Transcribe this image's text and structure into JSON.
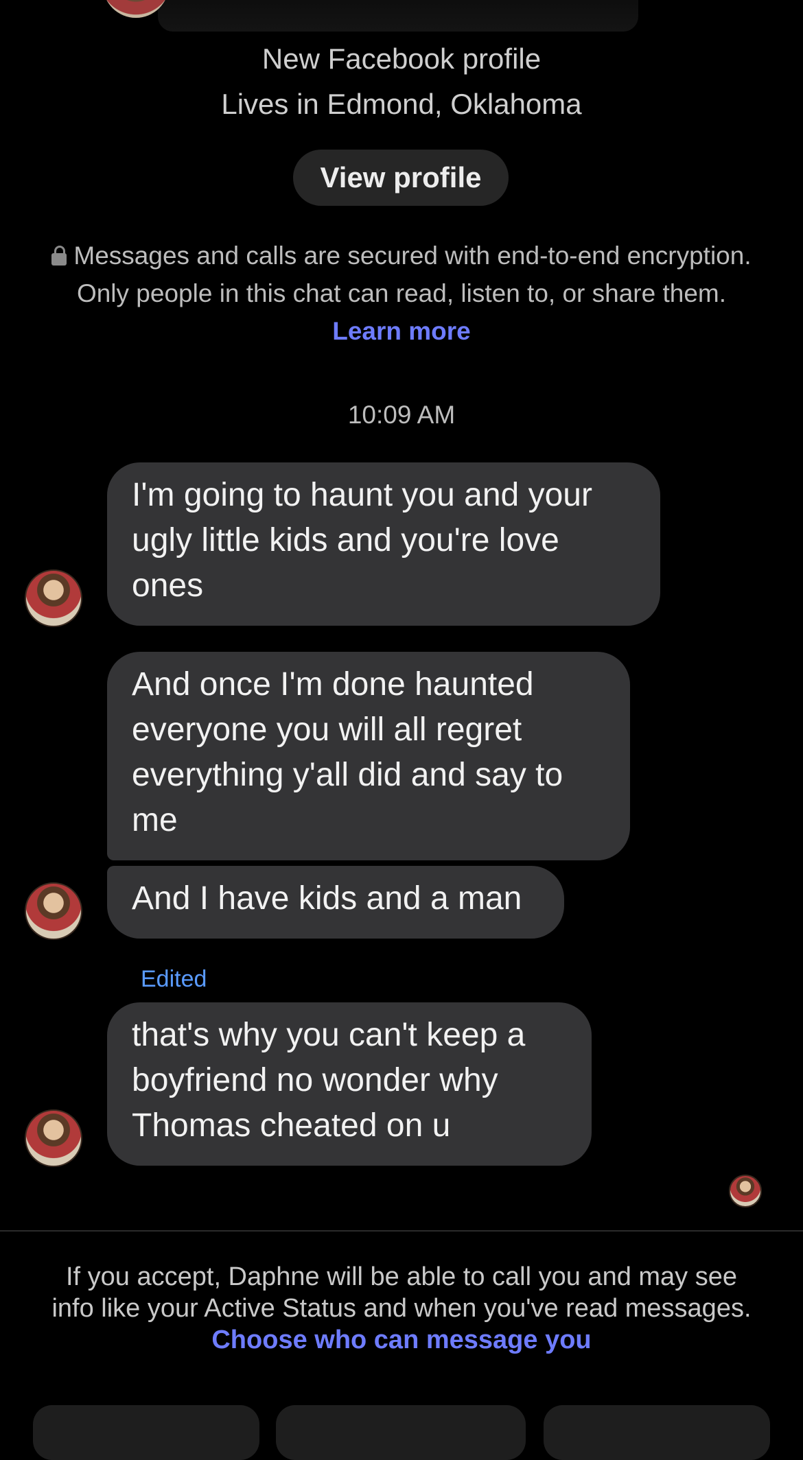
{
  "profile": {
    "subtitle": "New Facebook profile",
    "location": "Lives in Edmond, Oklahoma",
    "view_profile_label": "View profile"
  },
  "encryption": {
    "text": "Messages and calls are secured with end-to-end encryption. Only people in this chat can read, listen to, or share them.",
    "link": "Learn more"
  },
  "conversation": {
    "timestamp": "10:09 AM",
    "messages": [
      {
        "text": "I'm going to haunt you and your ugly little kids and you're love ones"
      },
      {
        "text": "And once I'm done haunted everyone you will all regret everything y'all did and say to me"
      },
      {
        "text": "And I have kids and a man"
      },
      {
        "text": "that's why you can't keep a boyfriend no wonder why Thomas cheated on u",
        "edited_label": "Edited"
      }
    ]
  },
  "request_footer": {
    "text": "If you accept, Daphne will be able to call you and may see info like your Active Status and when you've read messages.",
    "link": "Choose who can message you"
  },
  "colors": {
    "background": "#000000",
    "bubble": "#343436",
    "link": "#6e7cff",
    "edited": "#5a9bff"
  }
}
